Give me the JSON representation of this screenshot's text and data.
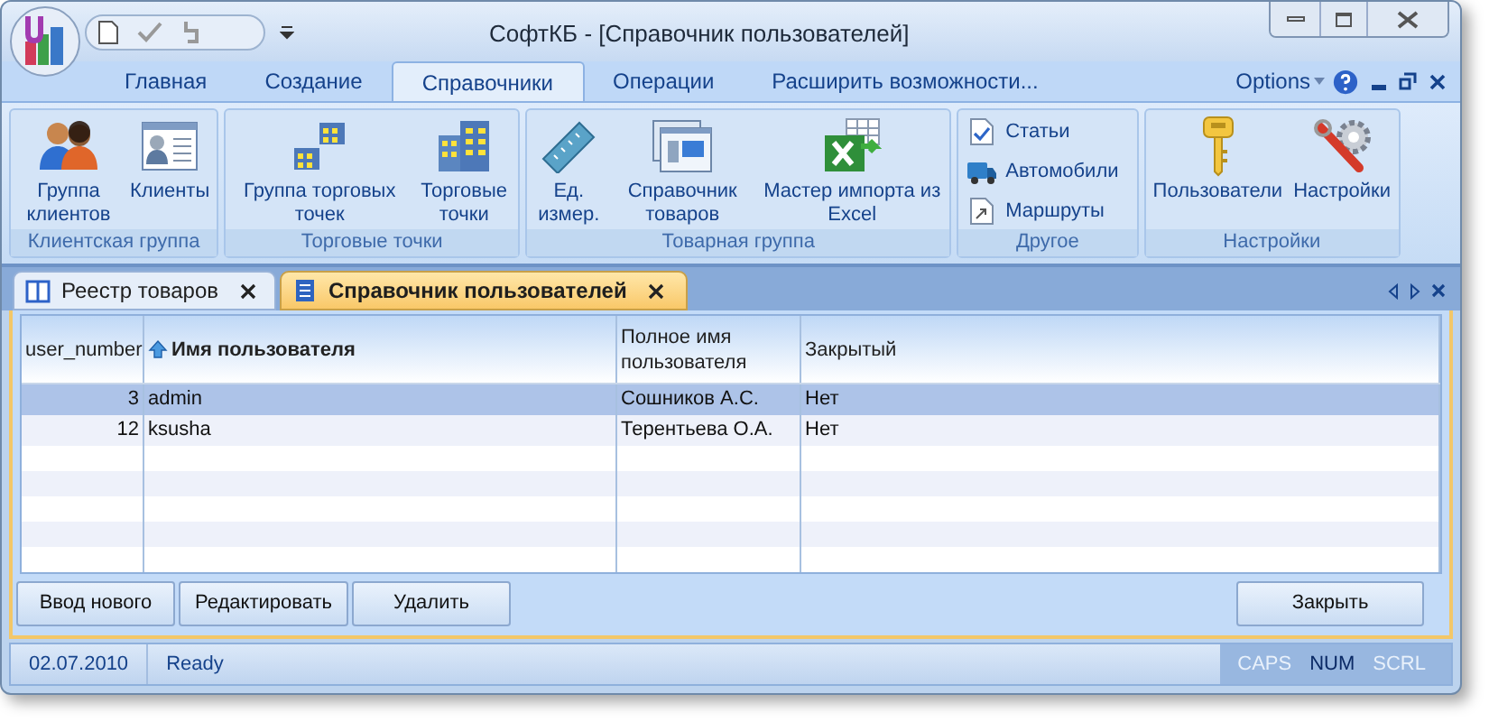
{
  "window": {
    "title": "СофтКБ - [Справочник пользователей]"
  },
  "ribbon": {
    "tabs": [
      {
        "label": "Главная",
        "selected": false
      },
      {
        "label": "Создание",
        "selected": false
      },
      {
        "label": "Справочники",
        "selected": true
      },
      {
        "label": "Операции",
        "selected": false
      },
      {
        "label": "Расширить возможности...",
        "selected": false
      }
    ],
    "options": "Options",
    "groups": [
      {
        "label": "Клиентская группа",
        "items": [
          {
            "kind": "large",
            "label": "Группа клиентов"
          },
          {
            "kind": "large",
            "label": "Клиенты"
          }
        ]
      },
      {
        "label": "Торговые точки",
        "items": [
          {
            "kind": "large",
            "label": "Группа торговых точек"
          },
          {
            "kind": "large",
            "label": "Торговые точки"
          }
        ]
      },
      {
        "label": "Товарная группа",
        "items": [
          {
            "kind": "large",
            "label": "Ед. измер."
          },
          {
            "kind": "large",
            "label": "Справочник товаров"
          },
          {
            "kind": "large",
            "label": "Мастер импорта из Excel"
          }
        ]
      },
      {
        "label": "Другое",
        "items": [
          {
            "kind": "small",
            "label": "Статьи"
          },
          {
            "kind": "small",
            "label": "Автомобили"
          },
          {
            "kind": "small",
            "label": "Маршруты"
          }
        ]
      },
      {
        "label": "Настройки",
        "items": [
          {
            "kind": "large",
            "label": "Пользователи"
          },
          {
            "kind": "large",
            "label": "Настройки"
          }
        ]
      }
    ]
  },
  "doc_tabs": [
    {
      "label": "Реестр товаров",
      "selected": false
    },
    {
      "label": "Справочник пользователей",
      "selected": true
    }
  ],
  "table": {
    "columns": [
      {
        "label": "user_number",
        "sorted": false
      },
      {
        "label": "Имя пользователя",
        "sorted": true
      },
      {
        "label": "Полное имя пользователя",
        "sorted": false
      },
      {
        "label": "Закрытый",
        "sorted": false
      }
    ],
    "rows": [
      {
        "cells": [
          "3",
          "admin",
          "Сошников А.С.",
          "Нет"
        ],
        "selected": true
      },
      {
        "cells": [
          "12",
          "ksusha",
          "Терентьева О.А.",
          "Нет"
        ],
        "selected": false
      }
    ]
  },
  "buttons": [
    "Ввод нового",
    "Редактировать",
    "Удалить"
  ],
  "close_button": "Закрыть",
  "status_bar": {
    "date": "02.07.2010",
    "message": "Ready",
    "indicators": [
      {
        "label": "CAPS",
        "on": false
      },
      {
        "label": "NUM",
        "on": true
      },
      {
        "label": "SCRL",
        "on": false
      }
    ]
  }
}
